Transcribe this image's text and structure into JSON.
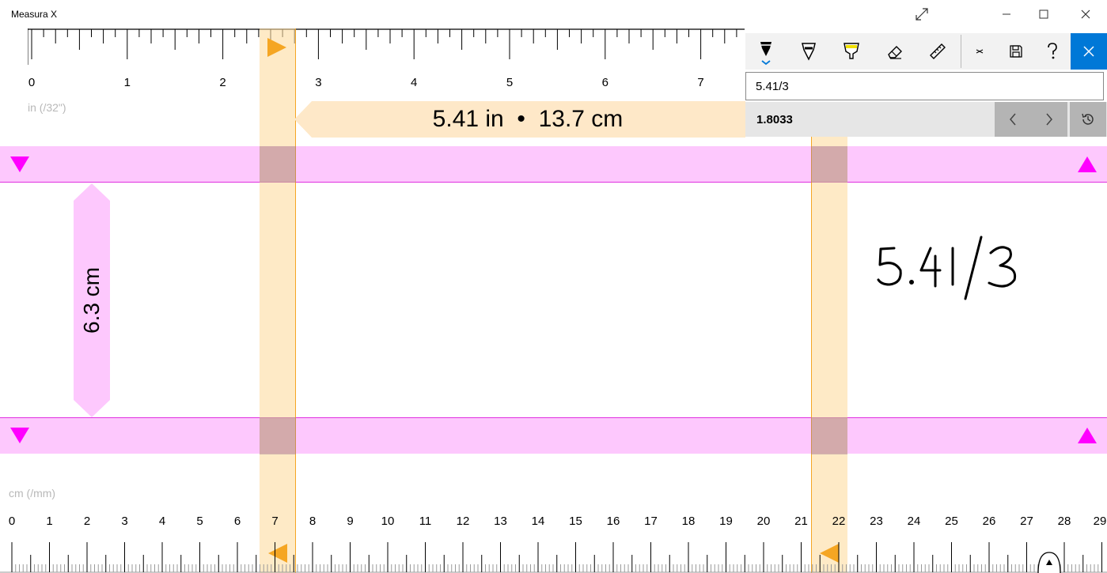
{
  "window": {
    "title": "Measura X",
    "resize_icon": "diagonal-resize-icon",
    "minimize_icon": "minimize-icon",
    "maximize_icon": "maximize-icon",
    "close_icon": "close-icon"
  },
  "inch_ruler": {
    "unit_label": "in (/32\")",
    "labels": [
      "0",
      "1",
      "2",
      "3",
      "4",
      "5",
      "6",
      "7"
    ]
  },
  "cm_ruler": {
    "unit_label": "cm (/mm)",
    "labels": [
      "0",
      "1",
      "2",
      "3",
      "4",
      "5",
      "6",
      "7",
      "8",
      "9",
      "10",
      "11",
      "12",
      "13",
      "14",
      "15",
      "16",
      "17",
      "18",
      "19",
      "20",
      "21",
      "22",
      "23",
      "24",
      "25",
      "26",
      "27",
      "28",
      "29"
    ]
  },
  "measurement": {
    "horizontal": "5.41 in  •  13.7 cm",
    "vertical": "6.3 cm"
  },
  "toolbar": {
    "tools": [
      {
        "name": "pen-tool",
        "icon": "pen-icon",
        "selected": true
      },
      {
        "name": "marker-tool",
        "icon": "marker-icon",
        "selected": false
      },
      {
        "name": "highlighter-tool",
        "icon": "highlighter-icon",
        "selected": false
      },
      {
        "name": "eraser-tool",
        "icon": "eraser-icon",
        "selected": false
      },
      {
        "name": "ruler-tool",
        "icon": "ruler-icon",
        "selected": false
      },
      {
        "name": "collapse-tool",
        "icon": "collapse-icon",
        "selected": false
      },
      {
        "name": "save-tool",
        "icon": "save-icon",
        "selected": false
      },
      {
        "name": "help-tool",
        "icon": "help-icon",
        "selected": false
      }
    ],
    "close_icon": "close-icon"
  },
  "calculator": {
    "expression": "5.41/3",
    "result": "1.8033",
    "prev_icon": "chevron-left-icon",
    "next_icon": "chevron-right-icon",
    "history_icon": "history-icon"
  },
  "ink": {
    "handwriting": "5.41/3"
  },
  "colors": {
    "pink_band": "#fdc8fd",
    "magenta": "#ff00ff",
    "orange": "#f5a623",
    "accent": "#0078d7"
  }
}
